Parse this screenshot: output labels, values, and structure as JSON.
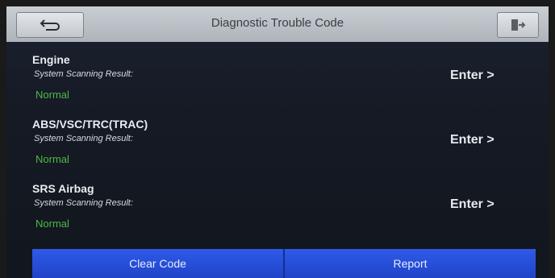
{
  "header": {
    "title": "Diagnostic Trouble Code",
    "back_icon": "back-arrow-icon",
    "exit_icon": "exit-icon"
  },
  "systems": [
    {
      "name": "Engine",
      "result_label": "System Scanning Result:",
      "status": "Normal",
      "enter_label": "Enter >"
    },
    {
      "name": "ABS/VSC/TRC(TRAC)",
      "result_label": "System Scanning Result:",
      "status": "Normal",
      "enter_label": "Enter >"
    },
    {
      "name": "SRS Airbag",
      "result_label": "System Scanning Result:",
      "status": "Normal",
      "enter_label": "Enter >"
    }
  ],
  "footer": {
    "clear_label": "Clear Code",
    "report_label": "Report"
  },
  "colors": {
    "status_normal": "#4fb84a",
    "footer_button": "#2f5be8",
    "title_bar": "#c0c5ca"
  }
}
